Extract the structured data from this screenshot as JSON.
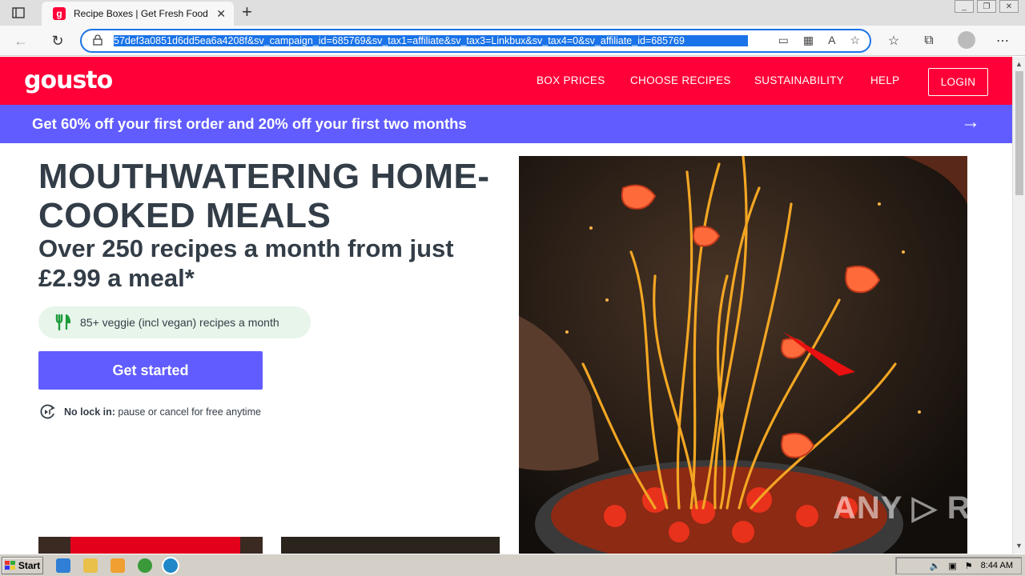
{
  "browser": {
    "tab_title": "Recipe Boxes | Get Fresh Food &",
    "tab_favicon": "g",
    "url": "57def3a0851d6dd5ea6a4208f&sv_campaign_id=685769&sv_tax1=affiliate&sv_tax3=Linkbux&sv_tax4=0&sv_affiliate_id=685769",
    "new_tab": "+",
    "close_tab": "✕"
  },
  "site": {
    "logo": "gousto",
    "nav": [
      "BOX PRICES",
      "CHOOSE RECIPES",
      "SUSTAINABILITY",
      "HELP"
    ],
    "login": "LOGIN",
    "promo": "Get 60% off your first order and 20% off your first two months",
    "promo_arrow": "→"
  },
  "hero": {
    "heading": "MOUTHWATERING HOME-COOKED MEALS",
    "subheading": "Over 250 recipes a month from just £2.99 a meal*",
    "veggie": "85+ veggie (incl vegan) recipes a month",
    "cta": "Get started",
    "nolock_bold": "No lock in:",
    "nolock_text": " pause or cancel for free anytime"
  },
  "watermark": "ANY ▷ RUN",
  "taskbar": {
    "start": "Start",
    "clock": "8:44 AM"
  },
  "colors": {
    "brand_red": "#ff0038",
    "brand_purple": "#615cff",
    "veggie_green": "#1e9b3a"
  }
}
